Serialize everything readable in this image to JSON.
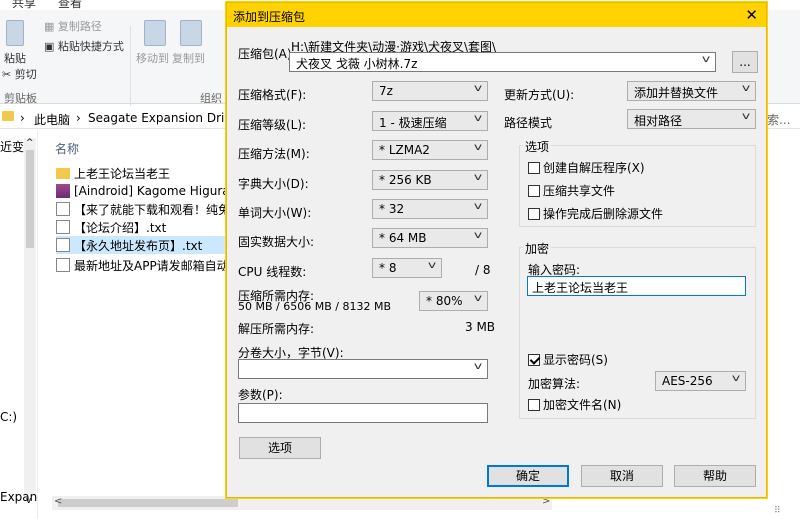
{
  "explorer": {
    "ribbon_tabs": [
      "共享",
      "查看"
    ],
    "ribbon": {
      "paste": "粘贴",
      "cut": "剪切",
      "copy_path": "复制路径",
      "paste_shortcut": "粘贴快捷方式",
      "move_to": "移动到",
      "copy_to": "复制到",
      "clipboard_group": "剪贴板",
      "organize_group": "组织"
    },
    "address": {
      "this_pc": "此电脑",
      "drive": "Seagate Expansion Drive (H:",
      "search_hint": "索..."
    },
    "nav": {
      "item1": "近变成",
      "item2": "C:)",
      "item3": "Expan"
    },
    "column_name": "名称",
    "files": [
      {
        "name": "上老王论坛当老王",
        "type": "folder"
      },
      {
        "name": "[Aindroid] Kagome Higurashi N",
        "type": "rar"
      },
      {
        "name": "【来了就能下载和观看！纯免费！",
        "type": "txt"
      },
      {
        "name": "【论坛介绍】.txt",
        "type": "txt"
      },
      {
        "name": "【永久地址发布页】.txt",
        "type": "txt"
      },
      {
        "name": "最新地址及APP请发邮箱自动获取",
        "type": "txt"
      }
    ]
  },
  "dialog": {
    "title": "添加到压缩包",
    "close": "✕",
    "archive_label": "压缩包(A)",
    "archive_path": "H:\\新建文件夹\\动漫·游戏\\犬夜叉\\套图\\",
    "archive_name": "犬夜叉 戈薇 小树林.7z",
    "browse": "...",
    "format_label": "压缩格式(F):",
    "format_value": "7z",
    "level_label": "压缩等级(L):",
    "level_value": "1 - 极速压缩",
    "method_label": "压缩方法(M):",
    "method_value": "* LZMA2",
    "dict_label": "字典大小(D):",
    "dict_value": "* 256 KB",
    "word_label": "单词大小(W):",
    "word_value": "* 32",
    "solid_label": "固实数据大小:",
    "solid_value": "* 64 MB",
    "cpu_label": "CPU 线程数:",
    "cpu_value": "* 8",
    "cpu_total": "/ 8",
    "mem_comp_label": "压缩所需内存:",
    "mem_comp_detail": "50 MB / 6506 MB / 8132 MB",
    "mem_comp_value": "* 80%",
    "mem_decomp_label": "解压所需内存:",
    "mem_decomp_value": "3 MB",
    "split_label": "分卷大小，字节(V):",
    "split_value": "",
    "params_label": "参数(P):",
    "params_value": "",
    "options_button": "选项",
    "update_label": "更新方式(U):",
    "update_value": "添加并替换文件",
    "pathmode_label": "路径模式",
    "pathmode_value": "相对路径",
    "options_group": "选项",
    "opt_sfx": "创建自解压程序(X)",
    "opt_shared": "压缩共享文件",
    "opt_delete": "操作完成后删除源文件",
    "encrypt_group": "加密",
    "password_label": "输入密码:",
    "password_value": "上老王论坛当老王",
    "show_password": "显示密码(S)",
    "enc_method_label": "加密算法:",
    "enc_method_value": "AES-256",
    "encrypt_names": "加密文件名(N)",
    "ok": "确定",
    "cancel": "取消",
    "help": "帮助"
  }
}
